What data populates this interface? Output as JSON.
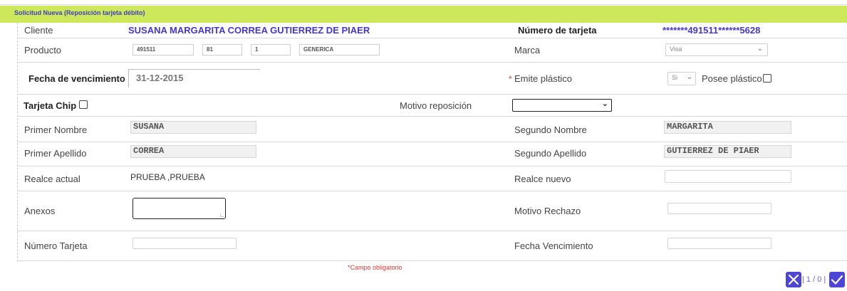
{
  "header": {
    "title": "Solicitud Nueva (Reposición tarjeta débito)"
  },
  "cliente": {
    "label": "Cliente",
    "value": "SUSANA MARGARITA CORREA GUTIERREZ DE PIAER"
  },
  "numero_tarjeta_top": {
    "label": "Número de tarjeta",
    "value": "*******491511******5628"
  },
  "producto": {
    "label": "Producto",
    "fields": [
      "491511",
      "81",
      "1",
      "GENERICA"
    ]
  },
  "marca": {
    "label": "Marca",
    "selected": "Visa"
  },
  "fecha_vencimiento": {
    "label": "Fecha de vencimiento",
    "value": "31-12-2015"
  },
  "emite_plastico": {
    "required_mark": "*",
    "label": "Emite plástico",
    "selected": "Si"
  },
  "posee_plastico": {
    "label": "Posee plástico",
    "checked": false
  },
  "tarjeta_chip": {
    "label": "Tarjeta Chip",
    "checked": false
  },
  "motivo_reposicion": {
    "label": "Motivo reposición",
    "selected": ""
  },
  "primer_nombre": {
    "label": "Primer Nombre",
    "value": "SUSANA"
  },
  "segundo_nombre": {
    "label": "Segundo Nombre",
    "value": "MARGARITA"
  },
  "primer_apellido": {
    "label": "Primer Apellido",
    "value": "CORREA"
  },
  "segundo_apellido": {
    "label": "Segundo Apellido",
    "value": "GUTIERREZ DE PIAER"
  },
  "realce_actual": {
    "label": "Realce actual",
    "value": "PRUEBA ,PRUEBA"
  },
  "realce_nuevo": {
    "label": "Realce nuevo",
    "value": ""
  },
  "anexos": {
    "label": "Anexos",
    "value": ""
  },
  "motivo_rechazo": {
    "label": "Motivo Rechazo",
    "value": ""
  },
  "numero_tarjeta_bottom": {
    "label": "Número Tarjeta",
    "value": ""
  },
  "fecha_vencimiento_bottom": {
    "label": "Fecha Vencimiento",
    "value": ""
  },
  "footer": {
    "required_note": "*Campo obligatorio",
    "pager": "| 1 / 0 |"
  },
  "icons": {
    "cancel": "close-icon",
    "confirm": "check-icon"
  },
  "colors": {
    "banner": "#cde85a",
    "accent": "#4d45d6",
    "client_text": "#4437d0",
    "required": "#e53935"
  }
}
